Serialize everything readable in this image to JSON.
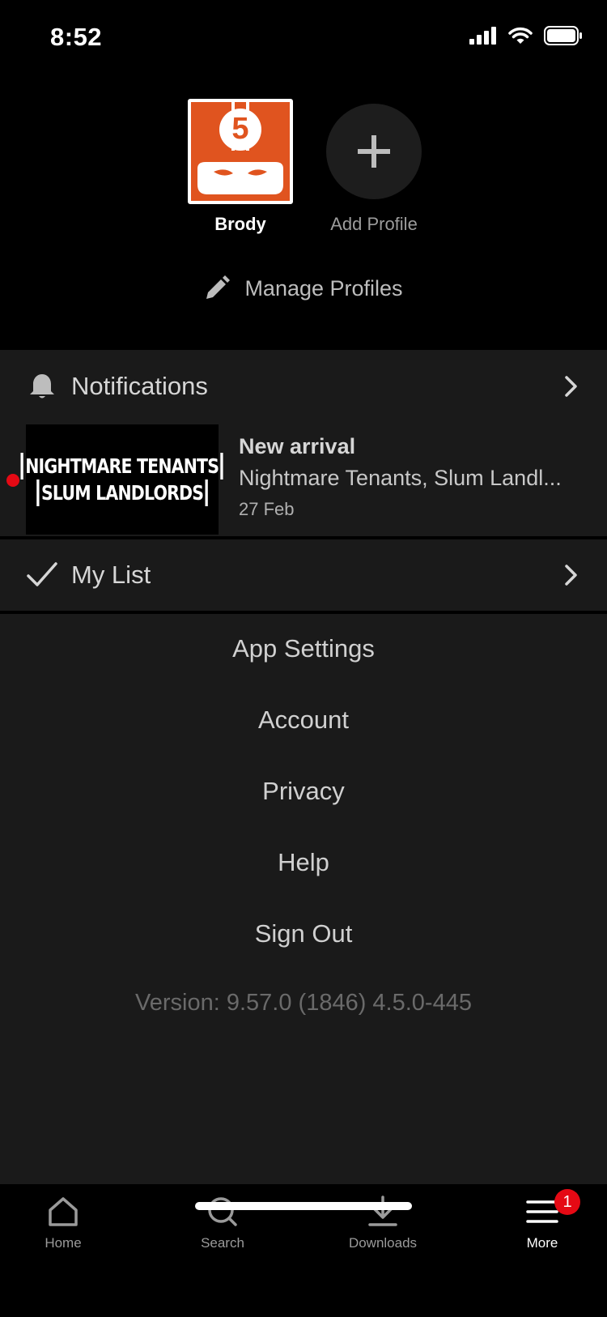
{
  "status_bar": {
    "time": "8:52"
  },
  "profiles": {
    "items": [
      {
        "name": "Brody",
        "avatar_number": "5",
        "avatar_color": "#e0541f"
      }
    ],
    "add_label": "Add Profile",
    "manage_label": "Manage Profiles"
  },
  "notifications": {
    "label": "Notifications",
    "item": {
      "thumb_line1": "NIGHTMARE TENANTS",
      "thumb_line2": "SLUM LANDLORDS",
      "title": "New arrival",
      "subtitle": "Nightmare Tenants, Slum Landl...",
      "date": "27 Feb",
      "unread_color": "#e50914"
    }
  },
  "my_list": {
    "label": "My List"
  },
  "settings": {
    "items": [
      "App Settings",
      "Account",
      "Privacy",
      "Help",
      "Sign Out"
    ],
    "version": "Version: 9.57.0 (1846) 4.5.0-445"
  },
  "bottom_nav": {
    "items": [
      {
        "label": "Home",
        "icon": "home-icon"
      },
      {
        "label": "Search",
        "icon": "search-icon"
      },
      {
        "label": "Downloads",
        "icon": "download-icon"
      },
      {
        "label": "More",
        "icon": "menu-icon",
        "badge": "1"
      }
    ],
    "active": "More"
  }
}
